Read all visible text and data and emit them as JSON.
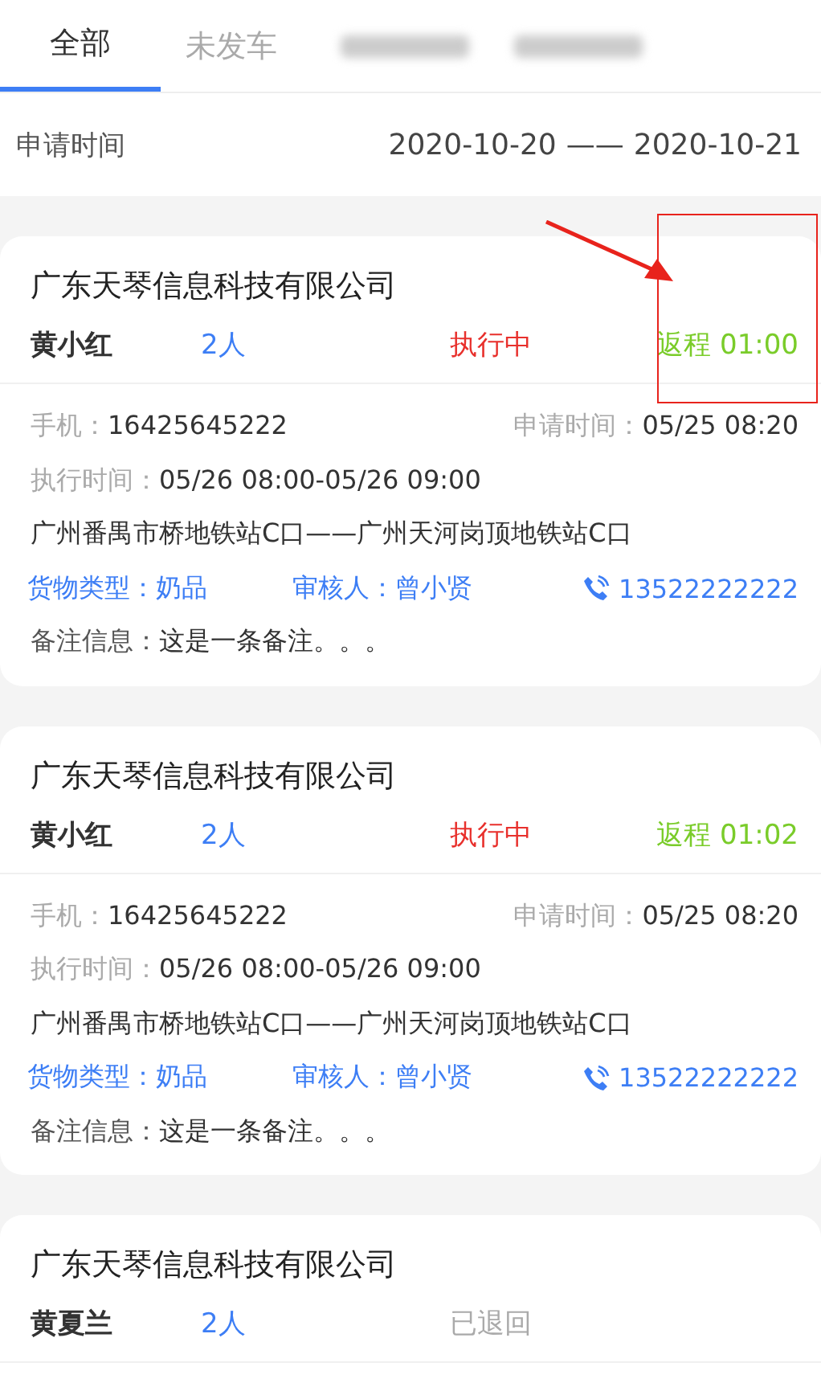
{
  "tabs": [
    {
      "kind": "text",
      "label": "全部",
      "selected": true
    },
    {
      "kind": "text",
      "label": "未发车",
      "selected": false
    },
    {
      "kind": "blurred",
      "selected": false
    },
    {
      "kind": "blurred",
      "selected": false
    }
  ],
  "filter": {
    "label": "申请时间",
    "start": "2020-10-20",
    "separator": "——",
    "end": "2020-10-21"
  },
  "orders": [
    {
      "company": "广东天琴信息科技有限公司",
      "name": "黄小红",
      "people": "2人",
      "status": "执行中",
      "kind": "active",
      "return_time": "返程 01:00",
      "phone_label": "手机：",
      "phone": "16425645222",
      "apply_label": "申请时间：",
      "apply_time": "05/25 08:20",
      "exec_label": "执行时间：",
      "exec_time": "05/26 08:00-05/26 09:00",
      "route": "广州番禺市桥地铁站C口——广州天河岗顶地铁站C口",
      "cargo": "货物类型：奶品",
      "reviewer": "审核人：曾小贤",
      "contact": "13522222222",
      "note_label": "备注信息：",
      "note": "这是一条备注。。。"
    },
    {
      "company": "广东天琴信息科技有限公司",
      "name": "黄小红",
      "people": "2人",
      "status": "执行中",
      "kind": "active",
      "return_time": "返程 01:02",
      "phone_label": "手机：",
      "phone": "16425645222",
      "apply_label": "申请时间：",
      "apply_time": "05/25 08:20",
      "exec_label": "执行时间：",
      "exec_time": "05/26 08:00-05/26 09:00",
      "route": "广州番禺市桥地铁站C口——广州天河岗顶地铁站C口",
      "cargo": "货物类型：奶品",
      "reviewer": "审核人：曾小贤",
      "contact": "13522222222",
      "note_label": "备注信息：",
      "note": "这是一条备注。。。"
    },
    {
      "company": "广东天琴信息科技有限公司",
      "name": "黄夏兰",
      "people": "2人",
      "status": "已退回",
      "kind": "returned"
    }
  ]
}
